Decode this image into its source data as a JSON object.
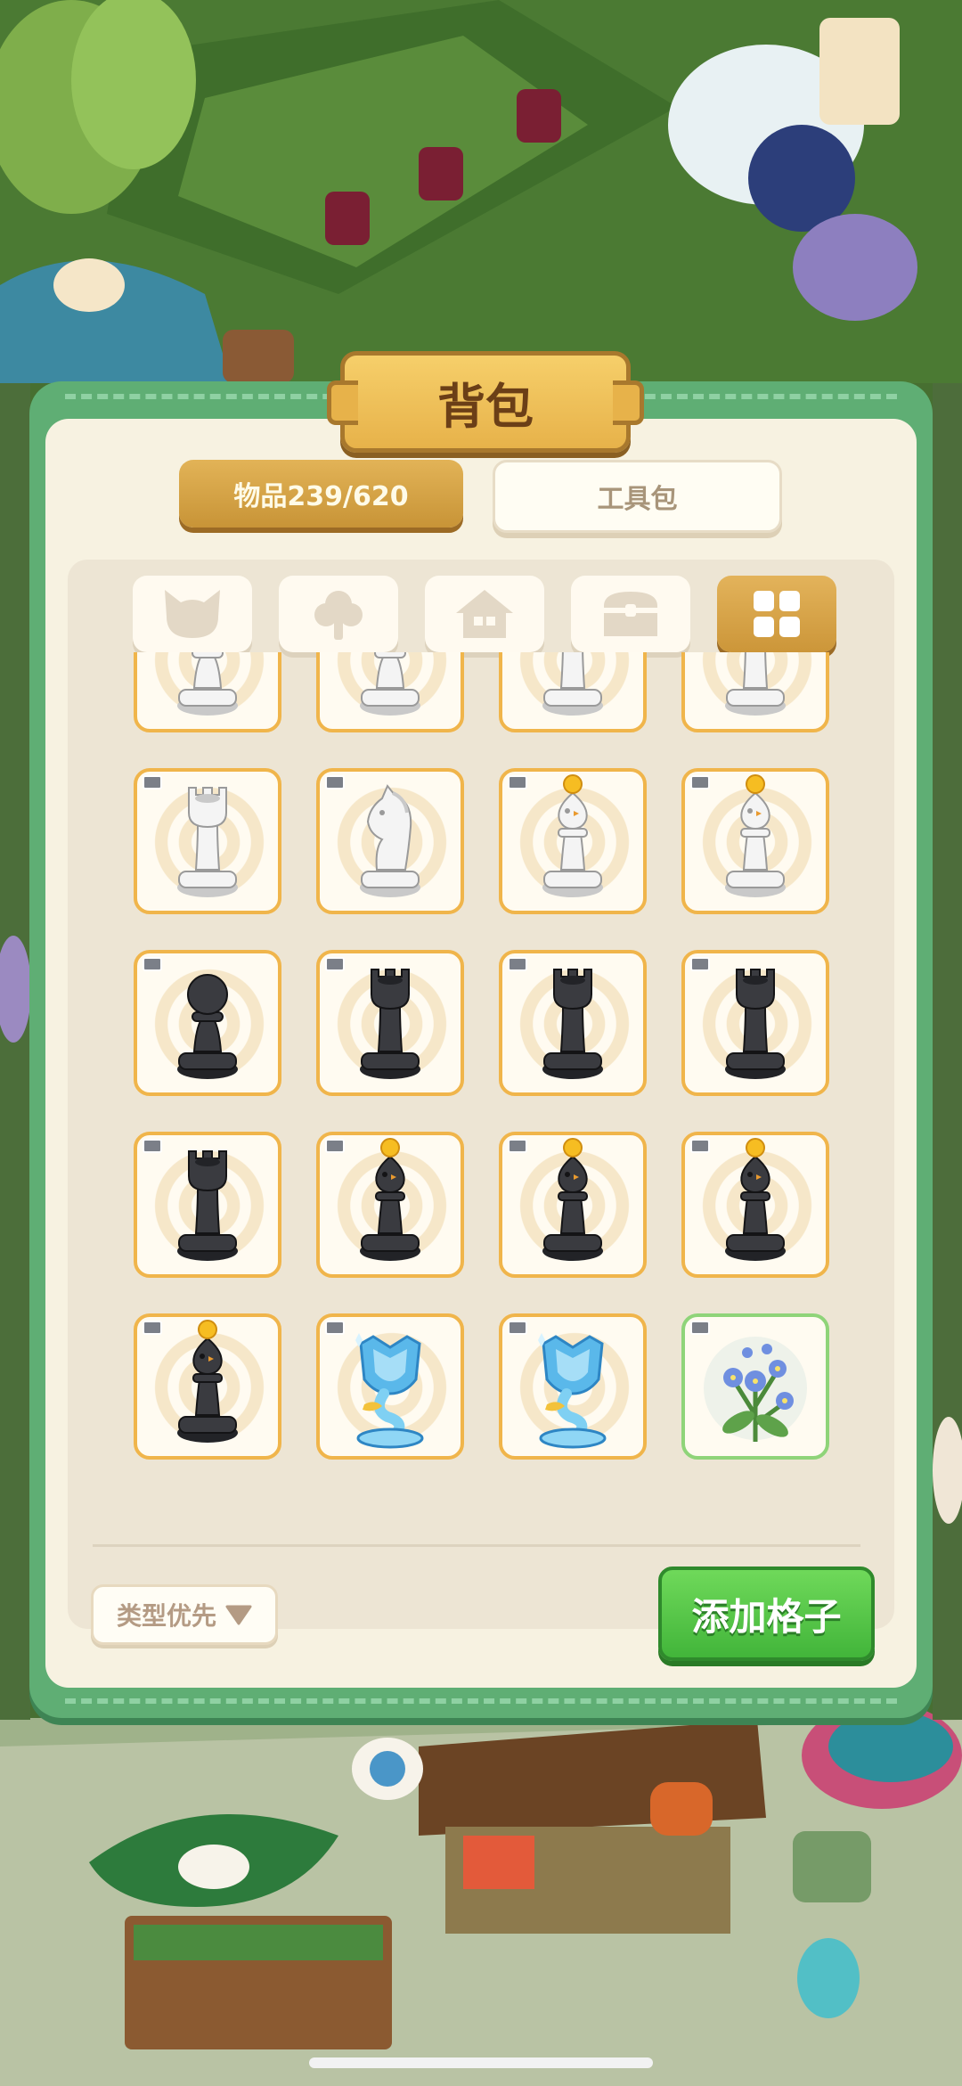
{
  "backpack": {
    "title": "背包",
    "tabs": [
      {
        "label": "物品239/620",
        "active": true
      },
      {
        "label": "工具包",
        "active": false
      }
    ],
    "categories": [
      {
        "icon": "cat-head-icon",
        "active": false
      },
      {
        "icon": "tree-icon",
        "active": false
      },
      {
        "icon": "house-icon",
        "active": false
      },
      {
        "icon": "treasure-chest-icon",
        "active": false
      },
      {
        "icon": "grid-icon",
        "active": true
      }
    ],
    "items": [
      {
        "piece": "pawn",
        "color": "white"
      },
      {
        "piece": "pawn",
        "color": "white"
      },
      {
        "piece": "rook",
        "color": "white"
      },
      {
        "piece": "rook",
        "color": "white"
      },
      {
        "piece": "rook",
        "color": "white"
      },
      {
        "piece": "knight",
        "color": "white"
      },
      {
        "piece": "bishop",
        "color": "white"
      },
      {
        "piece": "bishop",
        "color": "white"
      },
      {
        "piece": "pawn",
        "color": "black"
      },
      {
        "piece": "rook",
        "color": "black"
      },
      {
        "piece": "rook",
        "color": "black"
      },
      {
        "piece": "rook",
        "color": "black"
      },
      {
        "piece": "rook",
        "color": "black"
      },
      {
        "piece": "bishop",
        "color": "black"
      },
      {
        "piece": "bishop",
        "color": "black"
      },
      {
        "piece": "bishop",
        "color": "black"
      },
      {
        "piece": "bishop",
        "color": "black"
      },
      {
        "piece": "crystal-trophy",
        "color": "blue"
      },
      {
        "piece": "crystal-trophy",
        "color": "blue"
      },
      {
        "piece": "flower",
        "color": "green-frame"
      }
    ],
    "sort_label": "类型优先",
    "sort_icon": "triangle-down-icon",
    "add_button": "添加格子"
  },
  "colors": {
    "panel_green": "#5fae74",
    "panel_cream": "#f7f2e1",
    "accent_gold": "#d9a74a",
    "add_green": "#4fc03f"
  }
}
